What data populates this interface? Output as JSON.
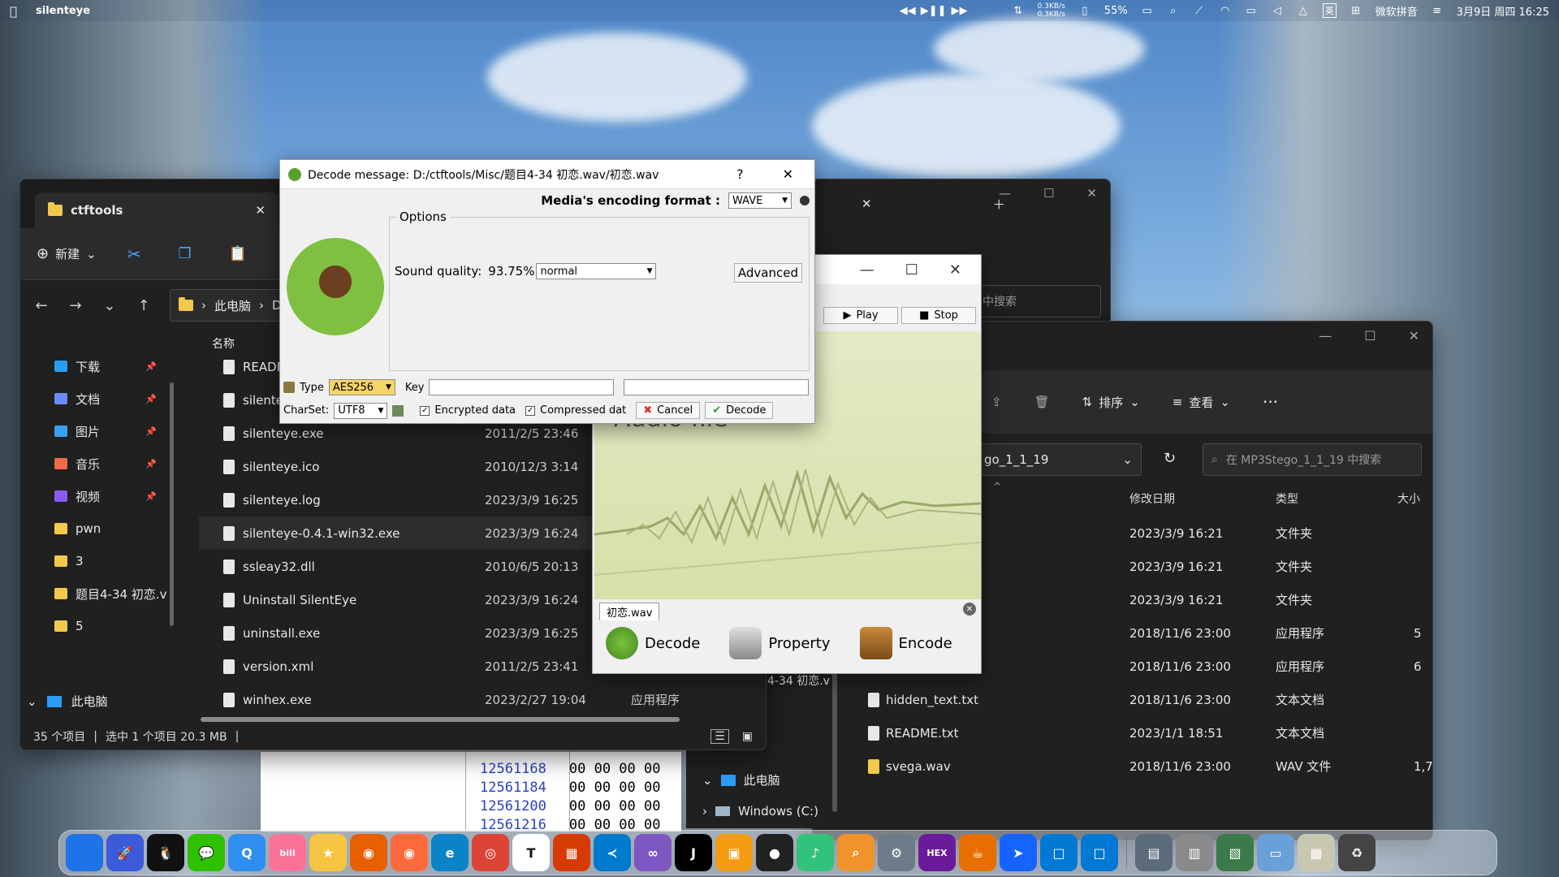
{
  "menubar": {
    "app_name": "silenteye",
    "net_up": "0.3KB/s",
    "net_down": "0.3KB/s",
    "battery": "55%",
    "ime_label": "微软拼音",
    "ime_badge": "英",
    "datetime": "3月9日 周四 16:25"
  },
  "explorer_left": {
    "tab_title": "ctftools",
    "new_button": "新建",
    "breadcrumb_root": "此电脑",
    "breadcrumb_next": "Da",
    "sidebar": [
      {
        "label": "下载",
        "icon": "download-icon",
        "pinned": true
      },
      {
        "label": "文档",
        "icon": "document-icon",
        "pinned": true
      },
      {
        "label": "图片",
        "icon": "image-icon",
        "pinned": true
      },
      {
        "label": "音乐",
        "icon": "music-icon",
        "pinned": true
      },
      {
        "label": "视频",
        "icon": "video-icon",
        "pinned": true
      },
      {
        "label": "pwn",
        "icon": "folder-icon",
        "pinned": false
      },
      {
        "label": "3",
        "icon": "folder-icon",
        "pinned": false
      },
      {
        "label": "题目4-34 初恋.v",
        "icon": "folder-icon",
        "pinned": false
      },
      {
        "label": "5",
        "icon": "folder-icon",
        "pinned": false
      }
    ],
    "this_pc": "此电脑",
    "column_name": "名称",
    "files": [
      {
        "name": "README",
        "date": "",
        "type": ""
      },
      {
        "name": "silenteye.",
        "date": "",
        "type": ""
      },
      {
        "name": "silenteye.exe",
        "date": "2011/2/5 23:46",
        "type": ""
      },
      {
        "name": "silenteye.ico",
        "date": "2010/12/3 3:14",
        "type": ""
      },
      {
        "name": "silenteye.log",
        "date": "2023/3/9 16:25",
        "type": ""
      },
      {
        "name": "silenteye-0.4.1-win32.exe",
        "date": "2023/3/9 16:24",
        "type": ""
      },
      {
        "name": "ssleay32.dll",
        "date": "2010/6/5 20:13",
        "type": ""
      },
      {
        "name": "Uninstall SilentEye",
        "date": "2023/3/9 16:24",
        "type": ""
      },
      {
        "name": "uninstall.exe",
        "date": "2023/3/9 16:25",
        "type": ""
      },
      {
        "name": "version.xml",
        "date": "2011/2/5 23:41",
        "type": ""
      },
      {
        "name": "winhex.exe",
        "date": "2023/2/27 19:04",
        "type": "应用程序"
      }
    ],
    "status_count": "35 个项目",
    "status_selected": "选中 1 个项目  20.3 MB"
  },
  "explorer_right": {
    "path_tail": "go_1_1_19",
    "search_placeholder": "在 MP3Stego_1_1_19 中搜索",
    "sort_label": "排序",
    "view_label": "查看",
    "col_modified": "修改日期",
    "col_type": "类型",
    "col_size": "大小",
    "rows": [
      {
        "name": "",
        "date": "2023/3/9 16:21",
        "type": "文件夹",
        "size": ""
      },
      {
        "name": "",
        "date": "2023/3/9 16:21",
        "type": "文件夹",
        "size": ""
      },
      {
        "name": "",
        "date": "2023/3/9 16:21",
        "type": "文件夹",
        "size": ""
      },
      {
        "name": "",
        "date": "2018/11/6 23:00",
        "type": "应用程序",
        "size": "5"
      },
      {
        "name": "",
        "date": "2018/11/6 23:00",
        "type": "应用程序",
        "size": "6"
      },
      {
        "name": "hidden_text.txt",
        "date": "2018/11/6 23:00",
        "type": "文本文档",
        "size": ""
      },
      {
        "name": "README.txt",
        "date": "2023/1/1 18:51",
        "type": "文本文档",
        "size": ""
      },
      {
        "name": "svega.wav",
        "date": "2018/11/6 23:00",
        "type": "WAV 文件",
        "size": "1,7"
      }
    ],
    "nav_this_pc": "此电脑",
    "nav_windows": "Windows (C:)",
    "tree_fragment": "4-34 初恋.v"
  },
  "back_search_placeholder": "中搜索",
  "hex": {
    "offsets": [
      "12561168",
      "12561184",
      "12561200",
      "12561216"
    ],
    "bytes": "00 00 00 00"
  },
  "silenteye_main": {
    "play_button": "Play",
    "stop_button": "Stop",
    "audio_label": "Audio file",
    "file_tab": "初恋.wav",
    "decode_button": "Decode",
    "property_button": "Property",
    "encode_button": "Encode"
  },
  "decode_dialog": {
    "title": "Decode message: D:/ctftools/Misc/题目4-34 初恋.wav/初恋.wav",
    "help": "?",
    "format_label": "Media's encoding format :",
    "format_value": "WAVE",
    "options_legend": "Options",
    "sound_quality_label": "Sound quality:",
    "sound_quality_value": "93.75%",
    "quality_mode": "normal",
    "advanced_button": "Advanced",
    "type_label": "Type",
    "type_value": "AES256",
    "key_label": "Key",
    "charset_label": "CharSet:",
    "charset_value": "UTF8",
    "encrypted_label": "Encrypted data",
    "compressed_label": "Compressed dat",
    "cancel_button": "Cancel",
    "decode_button": "Decode"
  },
  "dock": [
    {
      "name": "finder-icon",
      "color": "#1e73e8",
      "glyph": ""
    },
    {
      "name": "launchpad-icon",
      "color": "#3b5bdb",
      "glyph": "🚀"
    },
    {
      "name": "qq-icon",
      "color": "#111111",
      "glyph": "🐧"
    },
    {
      "name": "wechat-icon",
      "color": "#2dc100",
      "glyph": "💬"
    },
    {
      "name": "qq-browser-icon",
      "color": "#2f8ff0",
      "glyph": "Q"
    },
    {
      "name": "bilibili-icon",
      "color": "#fb7299",
      "glyph": "bili"
    },
    {
      "name": "notes-icon",
      "color": "#f5c542",
      "glyph": "★"
    },
    {
      "name": "firefox-icon",
      "color": "#e66000",
      "glyph": "◉"
    },
    {
      "name": "firefox-dev-icon",
      "color": "#ff6a3d",
      "glyph": "◉"
    },
    {
      "name": "edge-icon",
      "color": "#0a84c6",
      "glyph": "e"
    },
    {
      "name": "chrome-icon",
      "color": "#db4437",
      "glyph": "◎"
    },
    {
      "name": "typora-icon",
      "color": "#ffffff",
      "glyph": "T"
    },
    {
      "name": "office-icon",
      "color": "#d83b01",
      "glyph": "▦"
    },
    {
      "name": "vscode-icon",
      "color": "#007acc",
      "glyph": "≺"
    },
    {
      "name": "visual-studio-icon",
      "color": "#7e57c2",
      "glyph": "∞"
    },
    {
      "name": "jetbrains-icon",
      "color": "#000000",
      "glyph": "J"
    },
    {
      "name": "office-suite-icon",
      "color": "#f39c12",
      "glyph": "▣"
    },
    {
      "name": "obs-icon",
      "color": "#222222",
      "glyph": "●"
    },
    {
      "name": "music-player-icon",
      "color": "#31c27c",
      "glyph": "♪"
    },
    {
      "name": "search-tool-icon",
      "color": "#f0932b",
      "glyph": "⌕"
    },
    {
      "name": "settings-icon",
      "color": "#6c7a89",
      "glyph": "⚙"
    },
    {
      "name": "winhex-icon",
      "color": "#6a1b9a",
      "glyph": "HEX"
    },
    {
      "name": "java-icon",
      "color": "#e76f00",
      "glyph": "☕"
    },
    {
      "name": "feishu-icon",
      "color": "#1664ff",
      "glyph": "➤"
    },
    {
      "name": "window-app-icon",
      "color": "#0078d4",
      "glyph": "□"
    },
    {
      "name": "window-app-2-icon",
      "color": "#0078d4",
      "glyph": "□"
    },
    {
      "name": "recent-1-icon",
      "color": "#5b6b7b",
      "glyph": "▤"
    },
    {
      "name": "recent-2-icon",
      "color": "#8a8a8a",
      "glyph": "▥"
    },
    {
      "name": "recent-3-icon",
      "color": "#3b7a4a",
      "glyph": "▧"
    },
    {
      "name": "recent-4-icon",
      "color": "#6aa0d8",
      "glyph": "▭"
    },
    {
      "name": "recent-5-icon",
      "color": "#c8c8b0",
      "glyph": "▦"
    },
    {
      "name": "trash-icon",
      "color": "#444444",
      "glyph": "♻"
    }
  ]
}
